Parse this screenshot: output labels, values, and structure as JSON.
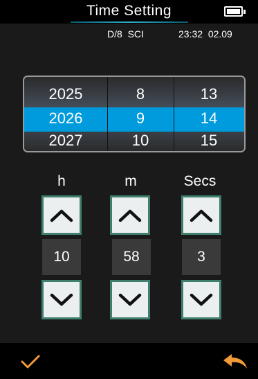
{
  "header": {
    "title": "Time Setting",
    "battery_icon": "battery-full-icon"
  },
  "status": {
    "mode": "D/8  SCI",
    "datetime": "23:32  02.09"
  },
  "date_picker": {
    "years": [
      "2025",
      "2026",
      "2027"
    ],
    "months": [
      "8",
      "9",
      "10"
    ],
    "days": [
      "13",
      "14",
      "15"
    ],
    "selected_color": "#009bdc"
  },
  "time_fields": {
    "hours": {
      "label": "h",
      "value": "10"
    },
    "minutes": {
      "label": "m",
      "value": "58"
    },
    "seconds": {
      "label": "Secs",
      "value": "3"
    }
  },
  "footer": {
    "confirm_icon": "checkmark-icon",
    "back_icon": "return-arrow-icon",
    "accent_color": "#f29a3a"
  }
}
